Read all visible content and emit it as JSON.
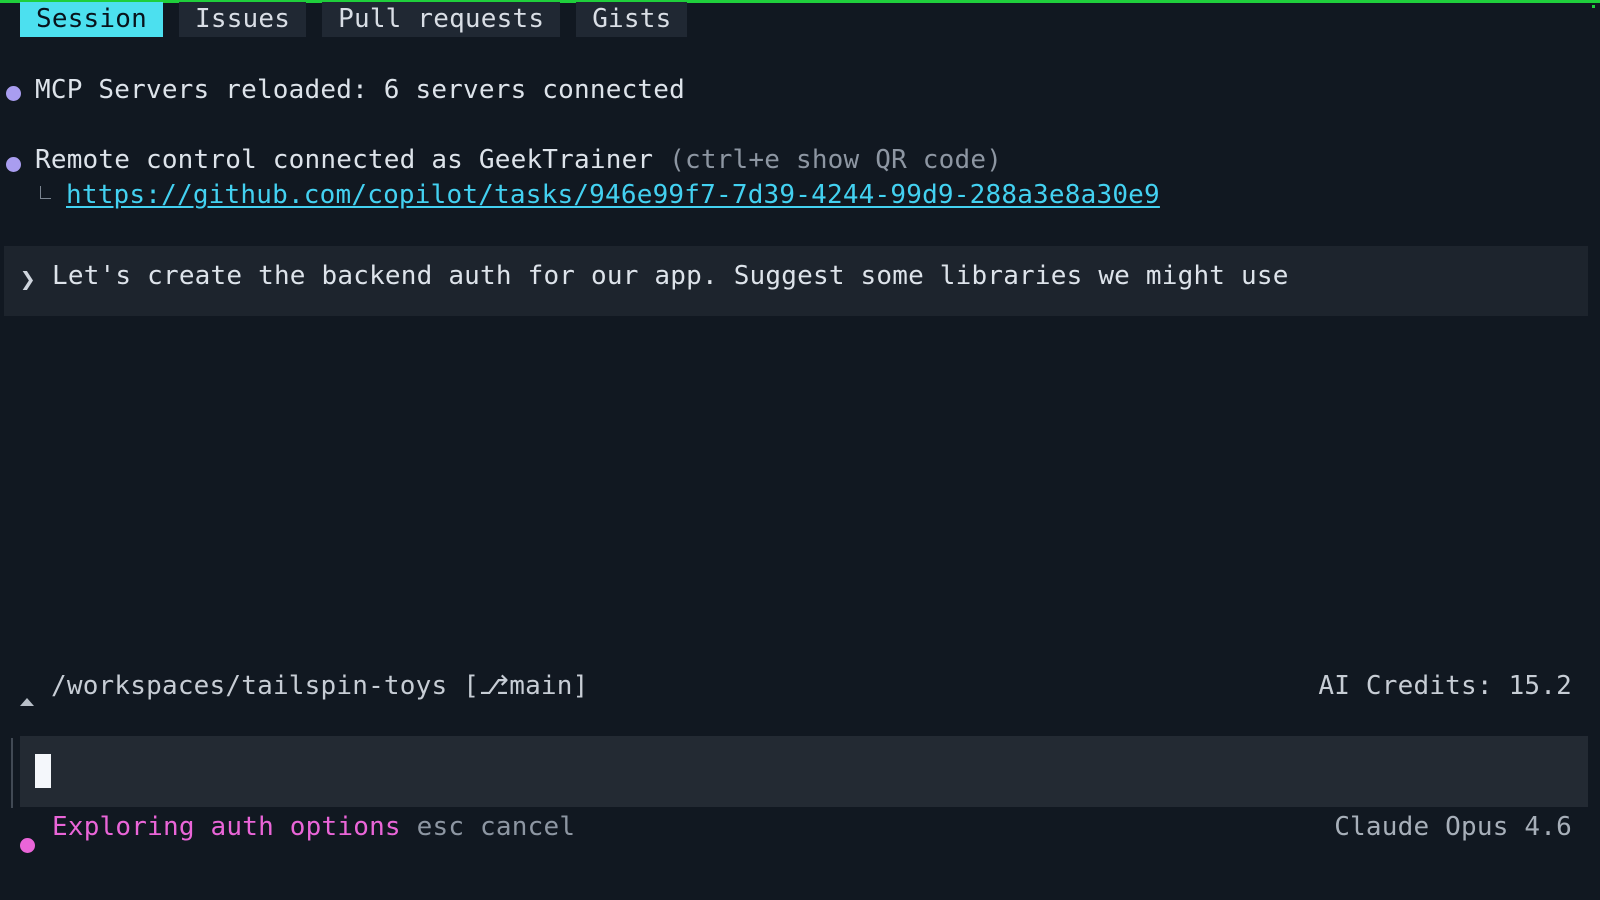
{
  "tabs": [
    {
      "label": "Session",
      "active": true
    },
    {
      "label": "Issues",
      "active": false
    },
    {
      "label": "Pull requests",
      "active": false
    },
    {
      "label": "Gists",
      "active": false
    }
  ],
  "messages": {
    "mcp": "MCP Servers reloaded: 6 servers connected",
    "remote": "Remote control connected as GeekTrainer",
    "remote_hint": "(ctrl+e show QR code)",
    "remote_link": "https://github.com/copilot/tasks/946e99f7-7d39-4244-99d9-288a3e8a30e9"
  },
  "prompt": {
    "chevron": "❯",
    "text": "Let's create the backend auth for our app. Suggest some libraries we might use"
  },
  "status": {
    "path": "/workspaces/tailspin-toys",
    "branch": "[⎇main]",
    "credits": "AI Credits: 15.2"
  },
  "activity": {
    "text": "Exploring auth options",
    "cancel": "esc cancel",
    "model": "Claude Opus 4.6"
  },
  "colors": {
    "accent": "#4ce0ef",
    "bullet": "#a99df0",
    "activity": "#ea65d8",
    "link": "#43d1f1",
    "top_line": "#1fcf3c"
  },
  "icons": {
    "message_bullet": "circle-bullet-icon",
    "branch": "branch-icon",
    "prompt": "chevron-right-icon",
    "cursor": "text-cursor-icon"
  }
}
